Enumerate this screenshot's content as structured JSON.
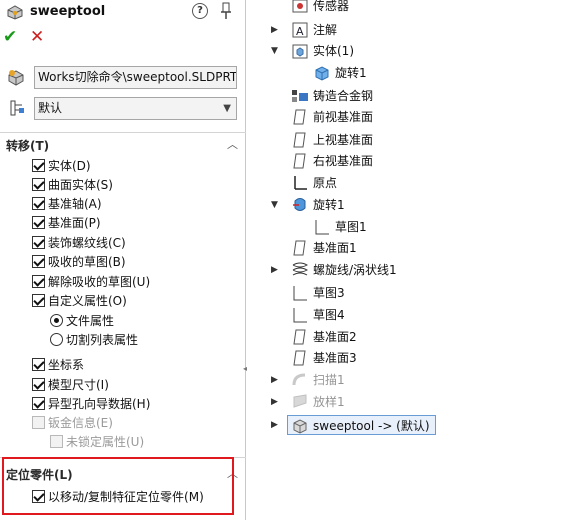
{
  "pm": {
    "title": "sweeptool",
    "help_glyph": "?",
    "file_path": "Works切除命令\\sweeptool.SLDPRT",
    "config_value": "默认",
    "section_transfer": "转移(T)",
    "options": [
      {
        "label": "实体(D)",
        "checked": true
      },
      {
        "label": "曲面实体(S)",
        "checked": true
      },
      {
        "label": "基准轴(A)",
        "checked": true
      },
      {
        "label": "基准面(P)",
        "checked": true
      },
      {
        "label": "装饰螺纹线(C)",
        "checked": true
      },
      {
        "label": "吸收的草图(B)",
        "checked": true
      },
      {
        "label": "解除吸收的草图(U)",
        "checked": true
      },
      {
        "label": "自定义属性(O)",
        "checked": true
      }
    ],
    "radio_file_props": "文件属性",
    "radio_cutlist_props": "切割列表属性",
    "options2": [
      {
        "label": "坐标系",
        "checked": true
      },
      {
        "label": "模型尺寸(I)",
        "checked": true
      },
      {
        "label": "异型孔向导数据(H)",
        "checked": true
      }
    ],
    "sheetmetal_info": "钣金信息(E)",
    "unlocked_props": "未锁定属性(U)",
    "section_locate": "定位零件(L)",
    "locate_option": "以移动/复制特征定位零件(M)"
  },
  "tree": {
    "sensors": "传感器",
    "annotations": "注解",
    "solid_bodies": "实体(1)",
    "revolve_body": "旋转1",
    "material": "铸造合金钢",
    "front_plane": "前视基准面",
    "top_plane": "上视基准面",
    "right_plane": "右视基准面",
    "origin": "原点",
    "revolve": "旋转1",
    "sketch1": "草图1",
    "plane1": "基准面1",
    "helix": "螺旋线/涡状线1",
    "sketch3": "草图3",
    "sketch4": "草图4",
    "plane2": "基准面2",
    "plane3": "基准面3",
    "sweep": "扫描1",
    "loft": "放样1",
    "derived_part": "sweeptool -> (默认)"
  },
  "colors": {
    "thread": "#e9e4a6",
    "cylinder_top": "#9a9a9a",
    "ok": "#1a9a1a",
    "cancel": "#cc1f1f",
    "highlight": "#e0191e"
  }
}
